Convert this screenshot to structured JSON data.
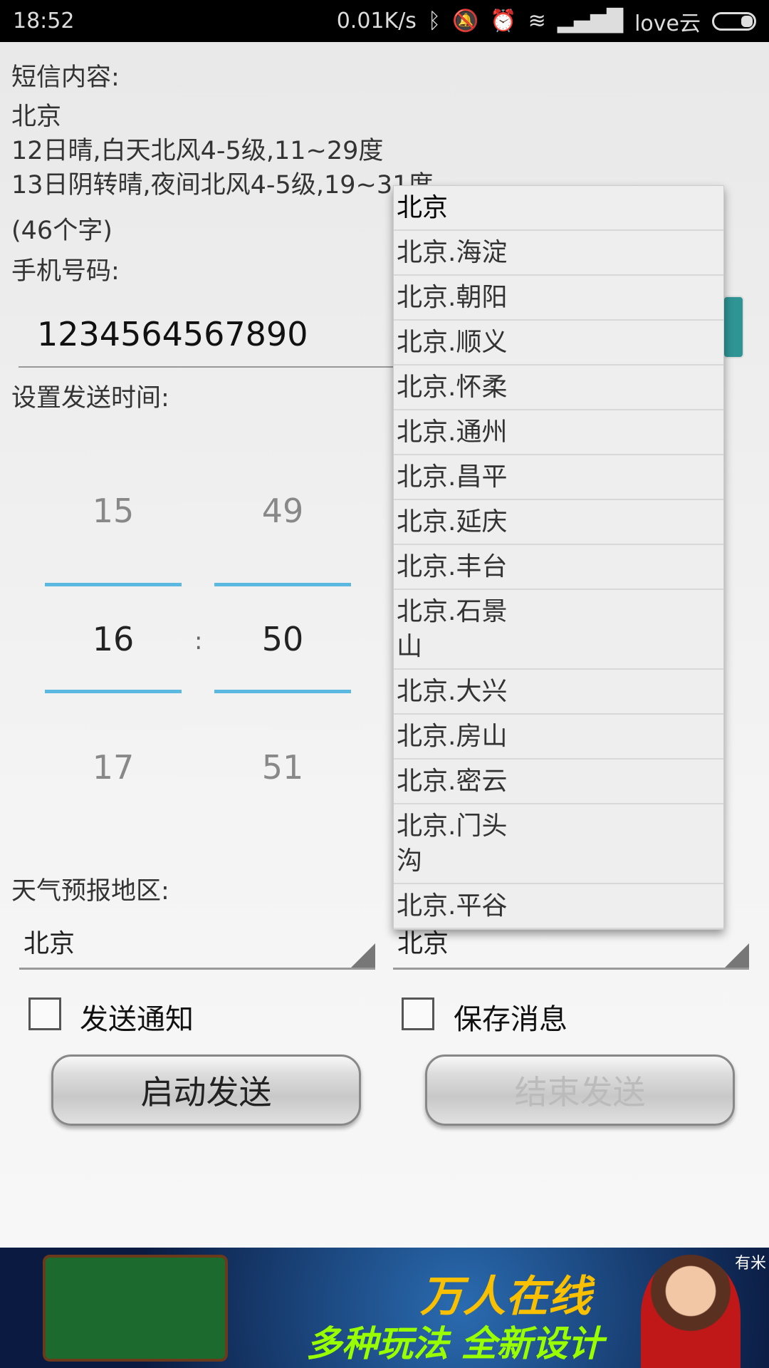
{
  "status_bar": {
    "time": "18:52",
    "net_speed": "0.01K/s",
    "carrier": "love云",
    "icons": [
      "bluetooth-icon",
      "mute-icon",
      "alarm-icon",
      "wifi-icon",
      "signal-icon",
      "battery-icon"
    ]
  },
  "sms": {
    "label": "短信内容:",
    "lines": [
      "北京",
      "12日晴,白天北风4-5级,11~29度",
      "13日阴转晴,夜间北风4-5级,19~31度"
    ],
    "count": "(46个字)"
  },
  "phone": {
    "label": "手机号码:",
    "value": "1234564567890"
  },
  "time": {
    "label": "设置发送时间:",
    "hour_prev": "15",
    "hour": "16",
    "hour_next": "17",
    "separator": ":",
    "minute_prev": "49",
    "minute": "50",
    "minute_next": "51"
  },
  "region": {
    "label": "天气预报地区:",
    "spinner1": "北京",
    "spinner2": "北京"
  },
  "dropdown": {
    "items": [
      "北京",
      "北京.海淀",
      "北京.朝阳",
      "北京.顺义",
      "北京.怀柔",
      "北京.通州",
      "北京.昌平",
      "北京.延庆",
      "北京.丰台",
      "北京.石景山",
      "北京.大兴",
      "北京.房山",
      "北京.密云",
      "北京.门头沟",
      "北京.平谷"
    ]
  },
  "checkboxes": {
    "notify": "发送通知",
    "save": "保存消息",
    "notify_checked": false,
    "save_checked": false
  },
  "buttons": {
    "start": "启动发送",
    "stop": "结束发送"
  },
  "ad": {
    "headline": "万人在线",
    "subline": "多种玩法 全新设计",
    "tag": "有米"
  },
  "colors": {
    "accent": "#5bb8e0",
    "teal": "#2f9494"
  }
}
